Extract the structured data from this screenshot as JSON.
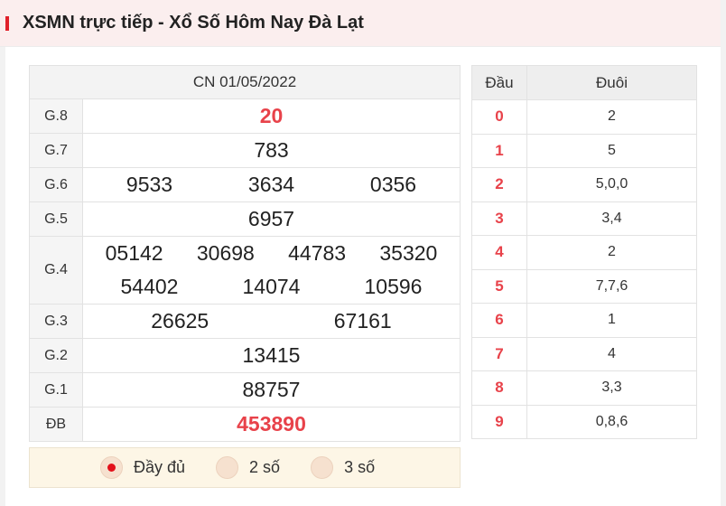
{
  "header": {
    "title": "XSMN trực tiếp - Xổ Số Hôm Nay Đà Lạt"
  },
  "results": {
    "date": "CN 01/05/2022",
    "prizes": [
      {
        "label": "G.8",
        "lines": [
          [
            "20"
          ]
        ],
        "highlight": true
      },
      {
        "label": "G.7",
        "lines": [
          [
            "783"
          ]
        ]
      },
      {
        "label": "G.6",
        "lines": [
          [
            "9533",
            "3634",
            "0356"
          ]
        ]
      },
      {
        "label": "G.5",
        "lines": [
          [
            "6957"
          ]
        ]
      },
      {
        "label": "G.4",
        "lines": [
          [
            "05142",
            "30698",
            "44783",
            "35320"
          ],
          [
            "54402",
            "14074",
            "10596"
          ]
        ]
      },
      {
        "label": "G.3",
        "lines": [
          [
            "26625",
            "67161"
          ]
        ]
      },
      {
        "label": "G.2",
        "lines": [
          [
            "13415"
          ]
        ]
      },
      {
        "label": "G.1",
        "lines": [
          [
            "88757"
          ]
        ]
      },
      {
        "label": "ĐB",
        "lines": [
          [
            "453890"
          ]
        ],
        "highlight": true
      }
    ]
  },
  "options": [
    {
      "label": "Đầy đủ",
      "checked": true
    },
    {
      "label": "2 số",
      "checked": false
    },
    {
      "label": "3 số",
      "checked": false
    }
  ],
  "loto": {
    "head_label": "Đầu",
    "tail_label": "Đuôi",
    "rows": [
      {
        "head": "0",
        "tail": "2"
      },
      {
        "head": "1",
        "tail": "5"
      },
      {
        "head": "2",
        "tail": "5,0,0"
      },
      {
        "head": "3",
        "tail": "3,4"
      },
      {
        "head": "4",
        "tail": "2"
      },
      {
        "head": "5",
        "tail": "7,7,6"
      },
      {
        "head": "6",
        "tail": "1"
      },
      {
        "head": "7",
        "tail": "4"
      },
      {
        "head": "8",
        "tail": "3,3"
      },
      {
        "head": "9",
        "tail": "0,8,6"
      }
    ]
  },
  "colors": {
    "accent": "#e8424a",
    "header_bg": "#fbeeee",
    "options_bg": "#fdf6e6"
  }
}
